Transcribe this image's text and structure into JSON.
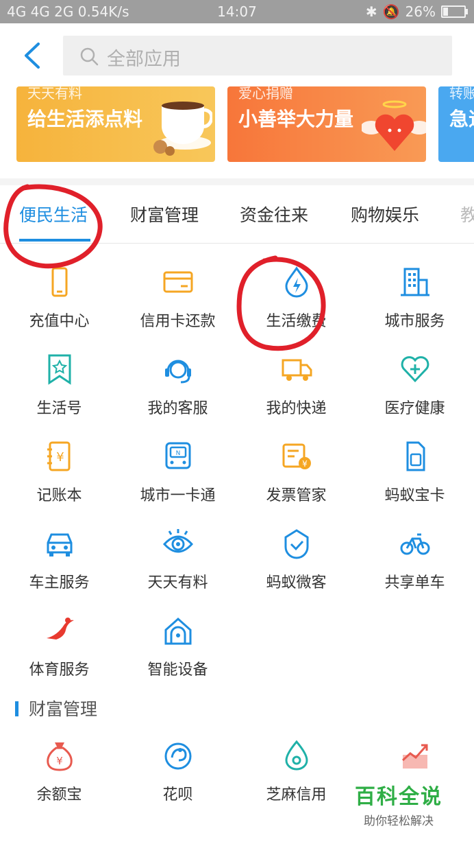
{
  "status_bar": {
    "signal": "4G 4G 2G",
    "speed": "0.54K/s",
    "time": "14:07",
    "battery": "26%",
    "battery_level": 0.26
  },
  "search": {
    "placeholder": "全部应用"
  },
  "banners": [
    {
      "tag": "天天有料",
      "title": "给生活添点料"
    },
    {
      "tag": "爱心捐赠",
      "title": "小善举大力量"
    },
    {
      "tag": "转账",
      "title": "急速"
    }
  ],
  "tabs": [
    "便民生活",
    "财富管理",
    "资金往来",
    "购物娱乐",
    "教"
  ],
  "active_tab": 0,
  "apps": [
    {
      "label": "充值中心",
      "icon": "phone-icon"
    },
    {
      "label": "信用卡还款",
      "icon": "credit-card-icon"
    },
    {
      "label": "生活缴费",
      "icon": "lightning-drop-icon"
    },
    {
      "label": "城市服务",
      "icon": "building-icon"
    },
    {
      "label": "生活号",
      "icon": "bookmark-star-icon"
    },
    {
      "label": "我的客服",
      "icon": "headset-icon"
    },
    {
      "label": "我的快递",
      "icon": "truck-icon"
    },
    {
      "label": "医疗健康",
      "icon": "medical-heart-icon"
    },
    {
      "label": "记账本",
      "icon": "ledger-icon"
    },
    {
      "label": "城市一卡通",
      "icon": "transit-card-icon"
    },
    {
      "label": "发票管家",
      "icon": "invoice-icon"
    },
    {
      "label": "蚂蚁宝卡",
      "icon": "sim-card-icon"
    },
    {
      "label": "车主服务",
      "icon": "car-icon"
    },
    {
      "label": "天天有料",
      "icon": "eye-icon"
    },
    {
      "label": "蚂蚁微客",
      "icon": "shield-check-icon"
    },
    {
      "label": "共享单车",
      "icon": "bicycle-icon"
    },
    {
      "label": "体育服务",
      "icon": "sports-icon"
    },
    {
      "label": "智能设备",
      "icon": "smart-device-icon"
    }
  ],
  "wealth_section": {
    "title": "财富管理",
    "apps": [
      {
        "label": "余额宝",
        "icon": "money-bag-icon"
      },
      {
        "label": "花呗",
        "icon": "huabei-icon"
      },
      {
        "label": "芝麻信用",
        "icon": "sesame-icon"
      },
      {
        "label": "",
        "icon": "stock-chart-icon"
      }
    ]
  },
  "watermark": {
    "line1": "百科全说",
    "line2": "助你轻松解决"
  },
  "colors": {
    "accent": "#1e8ee0",
    "orange": "#f5a623",
    "teal": "#1fb1a8",
    "red": "#e85a4f",
    "annotation": "#e0202a"
  }
}
